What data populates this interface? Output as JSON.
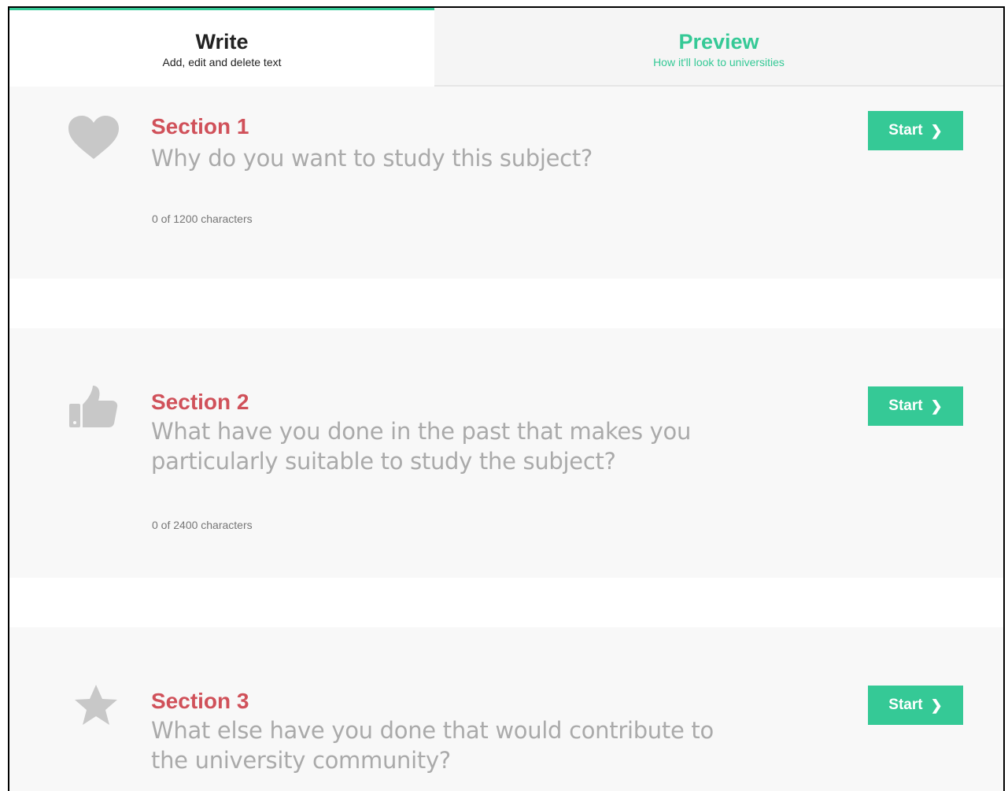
{
  "tabs": {
    "write": {
      "title": "Write",
      "subtitle": "Add, edit and delete text"
    },
    "preview": {
      "title": "Preview",
      "subtitle": "How it'll look to universities"
    }
  },
  "sections": [
    {
      "heading": "Section 1",
      "question": "Why do you want to study this subject?",
      "count": "0 of 1200 characters",
      "icon": "heart-icon",
      "button": "Start"
    },
    {
      "heading": "Section 2",
      "question": "What have you done in the past that makes you particularly suitable to study the subject?",
      "count": "0 of 2400 characters",
      "icon": "thumbs-up-icon",
      "button": "Start"
    },
    {
      "heading": "Section 3",
      "question": "What else have you done that would contribute to the university community?",
      "icon": "star-icon",
      "button": "Start"
    }
  ],
  "colors": {
    "accent": "#35c996",
    "section_heading": "#d0515a",
    "question": "#aaaaaa",
    "icon": "#c8c8c8",
    "section_bg": "#f8f8f8"
  }
}
